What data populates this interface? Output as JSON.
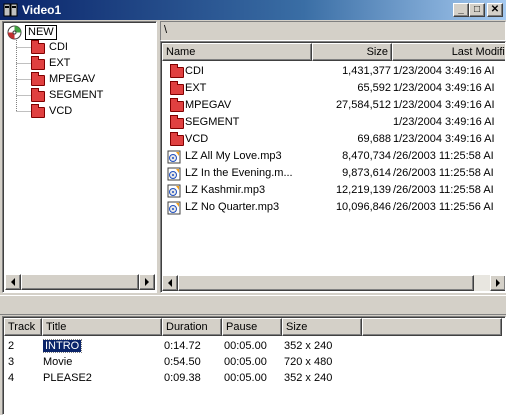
{
  "window": {
    "title": "Video1",
    "minimize": "_",
    "maximize": "□",
    "close": "✕"
  },
  "tree": {
    "root": "NEW",
    "children": [
      "CDI",
      "EXT",
      "MPEGAV",
      "SEGMENT",
      "VCD"
    ]
  },
  "path": "\\",
  "file_columns": [
    "Name",
    "Size",
    "Last Modifie"
  ],
  "files": [
    {
      "name": "CDI",
      "type": "folder",
      "size": "1,431,377",
      "modified": "1/23/2004 3:49:16 AI"
    },
    {
      "name": "EXT",
      "type": "folder",
      "size": "65,592",
      "modified": "1/23/2004 3:49:16 AI"
    },
    {
      "name": "MPEGAV",
      "type": "folder",
      "size": "27,584,512",
      "modified": "1/23/2004 3:49:16 AI"
    },
    {
      "name": "SEGMENT",
      "type": "folder",
      "size": "",
      "modified": "1/23/2004 3:49:16 AI"
    },
    {
      "name": "VCD",
      "type": "folder",
      "size": "69,688",
      "modified": "1/23/2004 3:49:16 AI"
    },
    {
      "name": "LZ  All My Love.mp3",
      "type": "audio",
      "size": "8,470,734",
      "modified": "/26/2003 11:25:58 AI"
    },
    {
      "name": "LZ  In the Evening.m...",
      "type": "audio",
      "size": "9,873,614",
      "modified": "/26/2003 11:25:58 AI"
    },
    {
      "name": "LZ  Kashmir.mp3",
      "type": "audio",
      "size": "12,219,139",
      "modified": "/26/2003 11:25:58 AI"
    },
    {
      "name": "LZ  No Quarter.mp3",
      "type": "audio",
      "size": "10,096,846",
      "modified": "/26/2003 11:25:56 AI"
    }
  ],
  "track_columns": [
    "Track",
    "Title",
    "Duration",
    "Pause",
    "Size"
  ],
  "tracks": [
    {
      "track": "2",
      "title": "INTRO",
      "duration": "0:14.72",
      "pause": "00:05.00",
      "size": "352 x 240"
    },
    {
      "track": "3",
      "title": "Movie",
      "duration": "0:54.50",
      "pause": "00:05.00",
      "size": "720 x 480"
    },
    {
      "track": "4",
      "title": "PLEASE2",
      "duration": "0:09.38",
      "pause": "00:05.00",
      "size": "352 x 240"
    }
  ],
  "colors": {
    "titlebar": "#0a246a",
    "folder": "#e04040",
    "selection": "#0a246a"
  }
}
